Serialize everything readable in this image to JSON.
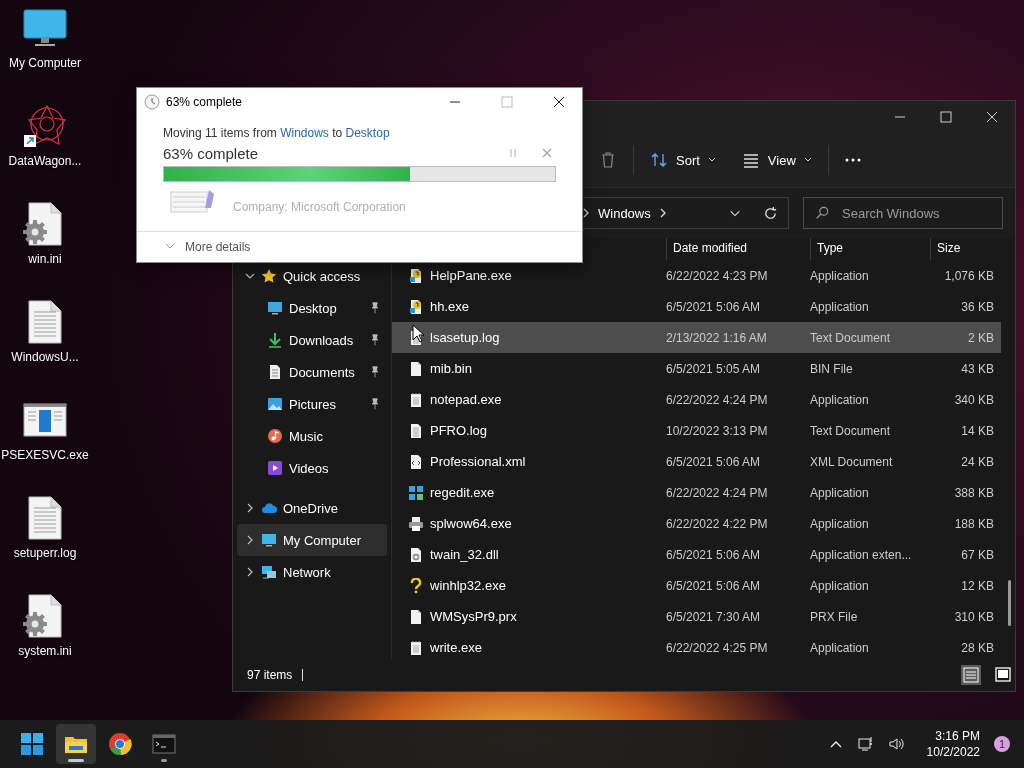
{
  "desktop_icons": [
    {
      "label": "My Computer",
      "kind": "monitor"
    },
    {
      "label": "DataWagon...",
      "kind": "shortcut"
    },
    {
      "label": "win.ini",
      "kind": "settings"
    },
    {
      "label": "WindowsU...",
      "kind": "text"
    },
    {
      "label": "PSEXESVC.exe",
      "kind": "program"
    },
    {
      "label": "setuperr.log",
      "kind": "text"
    },
    {
      "label": "system.ini",
      "kind": "settings"
    }
  ],
  "explorer": {
    "toolbar": {
      "sort": "Sort",
      "view": "View"
    },
    "address": {
      "crumb": "Windows"
    },
    "search": {
      "placeholder": "Search Windows"
    },
    "nav_items": [
      {
        "label": "Quick access",
        "kind": "star",
        "expanded": true,
        "selected": false,
        "children": [
          {
            "label": "Desktop",
            "kind": "desktop",
            "pinned": true,
            "selected": false
          },
          {
            "label": "Downloads",
            "kind": "download",
            "pinned": true,
            "selected": false
          },
          {
            "label": "Documents",
            "kind": "document",
            "pinned": true,
            "selected": false
          },
          {
            "label": "Pictures",
            "kind": "picture",
            "pinned": true,
            "selected": false
          },
          {
            "label": "Music",
            "kind": "music",
            "pinned": false,
            "selected": false
          },
          {
            "label": "Videos",
            "kind": "video",
            "pinned": false,
            "selected": false
          }
        ]
      },
      {
        "label": "OneDrive",
        "kind": "cloud",
        "expanded": false,
        "selected": false
      },
      {
        "label": "My Computer",
        "kind": "monitor",
        "expanded": false,
        "selected": true
      },
      {
        "label": "Network",
        "kind": "network",
        "expanded": false,
        "selected": false
      }
    ],
    "columns": [
      "Date modified",
      "Type",
      "Size"
    ],
    "rows": [
      {
        "name": "HelpPane.exe",
        "date": "6/22/2022 4:23 PM",
        "type": "Application",
        "size": "1,076 KB",
        "kind": "help",
        "selected": false
      },
      {
        "name": "hh.exe",
        "date": "6/5/2021 5:06 AM",
        "type": "Application",
        "size": "36 KB",
        "kind": "help",
        "selected": false
      },
      {
        "name": "lsasetup.log",
        "date": "2/13/2022 1:16 AM",
        "type": "Text Document",
        "size": "2 KB",
        "kind": "text",
        "selected": true
      },
      {
        "name": "mib.bin",
        "date": "6/5/2021 5:05 AM",
        "type": "BIN File",
        "size": "43 KB",
        "kind": "blank",
        "selected": false
      },
      {
        "name": "notepad.exe",
        "date": "6/22/2022 4:24 PM",
        "type": "Application",
        "size": "340 KB",
        "kind": "notepad",
        "selected": false
      },
      {
        "name": "PFRO.log",
        "date": "10/2/2022 3:13 PM",
        "type": "Text Document",
        "size": "14 KB",
        "kind": "text",
        "selected": false
      },
      {
        "name": "Professional.xml",
        "date": "6/5/2021 5:06 AM",
        "type": "XML Document",
        "size": "24 KB",
        "kind": "xml",
        "selected": false
      },
      {
        "name": "regedit.exe",
        "date": "6/22/2022 4:24 PM",
        "type": "Application",
        "size": "388 KB",
        "kind": "registry",
        "selected": false
      },
      {
        "name": "splwow64.exe",
        "date": "6/22/2022 4:22 PM",
        "type": "Application",
        "size": "188 KB",
        "kind": "printer",
        "selected": false
      },
      {
        "name": "twain_32.dll",
        "date": "6/5/2021 5:06 AM",
        "type": "Application exten...",
        "size": "67 KB",
        "kind": "dll",
        "selected": false
      },
      {
        "name": "winhlp32.exe",
        "date": "6/5/2021 5:06 AM",
        "type": "Application",
        "size": "12 KB",
        "kind": "question",
        "selected": false
      },
      {
        "name": "WMSysPr9.prx",
        "date": "6/5/2021 7:30 AM",
        "type": "PRX File",
        "size": "310 KB",
        "kind": "blank",
        "selected": false
      },
      {
        "name": "write.exe",
        "date": "6/22/2022 4:25 PM",
        "type": "Application",
        "size": "28 KB",
        "kind": "notepad",
        "selected": false
      }
    ],
    "status": "97 items",
    "view_buttons": [
      {
        "kind": "details",
        "selected": true
      },
      {
        "kind": "preview",
        "selected": false
      }
    ]
  },
  "dialog": {
    "title": "63% complete",
    "message": {
      "before": "Moving 11 items from ",
      "source": "Windows",
      "middle": " to ",
      "destination": "Desktop"
    },
    "heading": "63% complete",
    "level": 0.63,
    "behind_text": "Company: Microsoft Corporation",
    "more_details": "More details"
  },
  "taskbar": {
    "apps": [
      {
        "kind": "start",
        "active": false,
        "running": false
      },
      {
        "kind": "explorer",
        "active": true,
        "running": true
      },
      {
        "kind": "browser",
        "active": false,
        "running": false
      },
      {
        "kind": "terminal",
        "active": false,
        "running": true
      }
    ],
    "time": "3:16 PM",
    "date": "10/2/2022",
    "notifications": "1"
  }
}
